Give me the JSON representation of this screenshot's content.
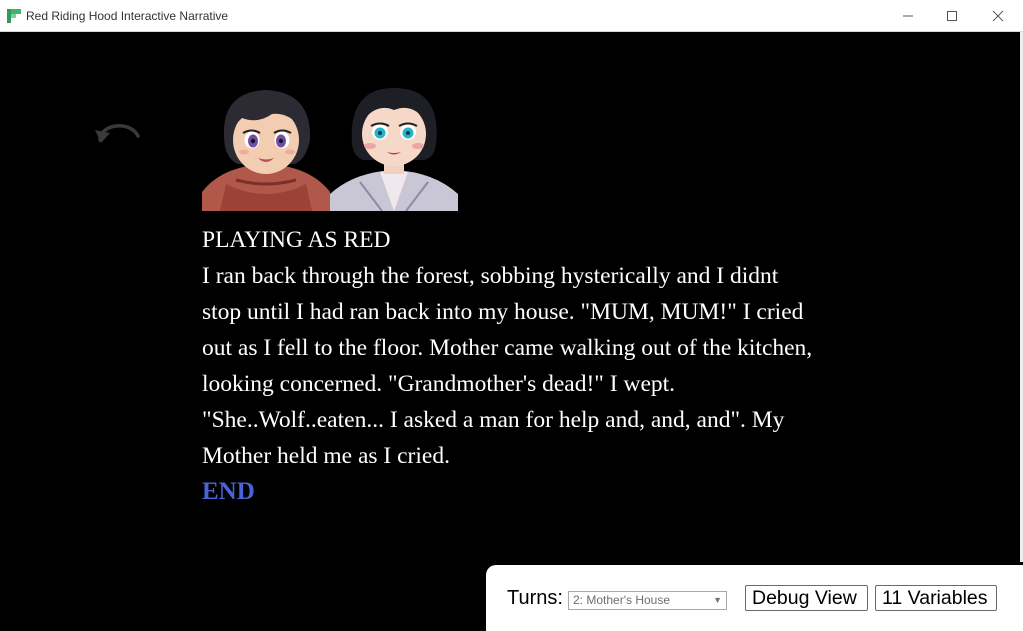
{
  "window": {
    "title": "Red Riding Hood Interactive Narrative"
  },
  "icons": {
    "app": "app-logo-icon",
    "minimize": "minimize-icon",
    "maximize": "maximize-icon",
    "close": "close-icon",
    "undo": "undo-icon"
  },
  "portraits": [
    "red-portrait",
    "mother-portrait"
  ],
  "story": {
    "heading": "PLAYING AS RED",
    "text": "I ran back through the forest, sobbing hysterically and I didnt stop until I had ran back into my house. \"MUM, MUM!\" I cried out as I fell to the floor. Mother came walking out of the kitchen, looking concerned. \"Grandmother's dead!\" I wept. \"She..Wolf..eaten... I asked a man for help and, and, and\". My Mother held me as I cried.",
    "end_link": "END"
  },
  "panel": {
    "turns_label": "Turns:",
    "turns_selected": "2: Mother's House",
    "debug_button": "Debug View",
    "variables_button": "11 Variables"
  },
  "colors": {
    "background": "#000000",
    "text": "#ffffff",
    "end_link": "#4a63d9",
    "panel": "#ffffff"
  }
}
